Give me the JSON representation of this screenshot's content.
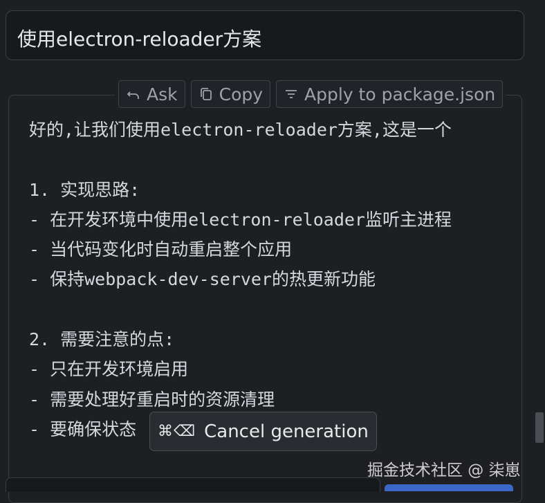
{
  "input": {
    "value": "使用electron-reloader方案"
  },
  "toolbar": {
    "ask_label": "Ask",
    "copy_label": "Copy",
    "apply_label": "Apply to package.json"
  },
  "response": {
    "lines": [
      "好的,让我们使用electron-reloader方案,这是一个",
      "",
      "1. 实现思路:",
      "- 在开发环境中使用electron-reloader监听主进程",
      "- 当代码变化时自动重启整个应用",
      "- 保持webpack-dev-server的热更新功能",
      "",
      "2. 需要注意的点:",
      "- 只在开发环境启用",
      "- 需要处理好重启时的资源清理",
      "- 要确保状态"
    ]
  },
  "tooltip": {
    "keys": "⌘⌫",
    "label": "Cancel generation"
  },
  "watermark": {
    "text": "掘金技术社区 @ 柒崽"
  },
  "colors": {
    "background": "#1e1f23",
    "accent": "#3b68c8"
  }
}
